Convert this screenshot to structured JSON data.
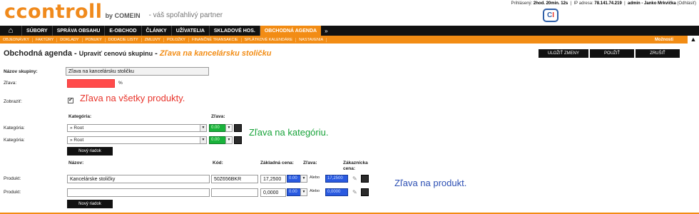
{
  "header": {
    "logo": "ccontroll",
    "logo_by": "by COMEIN",
    "tagline": "- váš spoľahlivý partner",
    "session_label": "Prihlásený:",
    "session_value": "2hod. 20min. 12s",
    "ip_label": "IP adresa:",
    "ip_value": "78.141.74.219",
    "user": "admin - Janko Mrkvička",
    "logout": "(Odhlásiť)"
  },
  "nav": {
    "home_icon": "home-icon",
    "items": [
      "SÚBORY",
      "SPRÁVA OBSAHU",
      "E-OBCHOD",
      "ČLÁNKY",
      "UŽÍVATELIA",
      "SKLADOVÉ HOS.",
      "OBCHODNÁ AGENDA"
    ],
    "more": "»"
  },
  "subnav": {
    "items": [
      "OBJEDNÁVKY",
      "FAKTÚRY",
      "DOKLADY",
      "PONUKY",
      "DODACIE LISTY",
      "ZMLUVY",
      "POLOŽKY",
      "FINANČNÉ TRANSAKCIE",
      "SPLÁTKOVÉ KALENDÁRE",
      "NASTAVENIA"
    ],
    "options": "Možnosti"
  },
  "title": {
    "main": "Obchodná agenda",
    "sub": "Upraviť cenovú skupinu",
    "highlight": "Zľava na kancelársku stoličku"
  },
  "buttons": {
    "save": "ULOŽIŤ ZMENY",
    "use": "POUŽIŤ",
    "cancel": "ZRUŠIŤ"
  },
  "form": {
    "group_name_label": "Názov skupiny:",
    "group_name_value": "Zľava na kancelársku stoličku",
    "discount_label": "Zľava:",
    "discount_unit": "%",
    "show_label": "Zobraziť:",
    "show_checked": "✔",
    "note_all": "Zľava na všetky produkty.",
    "category_header": "Kategória:",
    "category_discount_header": "Zľava:",
    "category_label": "Kategória:",
    "categories": [
      {
        "value": "» Root",
        "discount": "0.00"
      },
      {
        "value": "» Root",
        "discount": "0.00"
      }
    ],
    "note_category": "Zľava na kategóriu.",
    "new_row": "Nový riadok",
    "product_headers": {
      "name": "Názov:",
      "code": "Kód:",
      "base_price": "Základná cena:",
      "discount": "Zľava:",
      "customer_price": "Zákaznícka cena:"
    },
    "product_label": "Produkt:",
    "products": [
      {
        "name": "Kancelárske stoličky",
        "code": "50Z656BKR",
        "base_price": "17,2500",
        "discount": "0.00",
        "or": "Alebo",
        "customer_price": "17,2500"
      },
      {
        "name": "",
        "code": "",
        "base_price": "0,0000",
        "discount": "0.00",
        "or": "Alebo",
        "customer_price": "0,0000"
      }
    ],
    "note_product": "Zľava na produkt."
  },
  "colors": {
    "accent": "#f28c14",
    "nav_bg": "#111111",
    "red": "#ff4b4b",
    "green": "#19b23b",
    "blue": "#2a5ae0"
  }
}
